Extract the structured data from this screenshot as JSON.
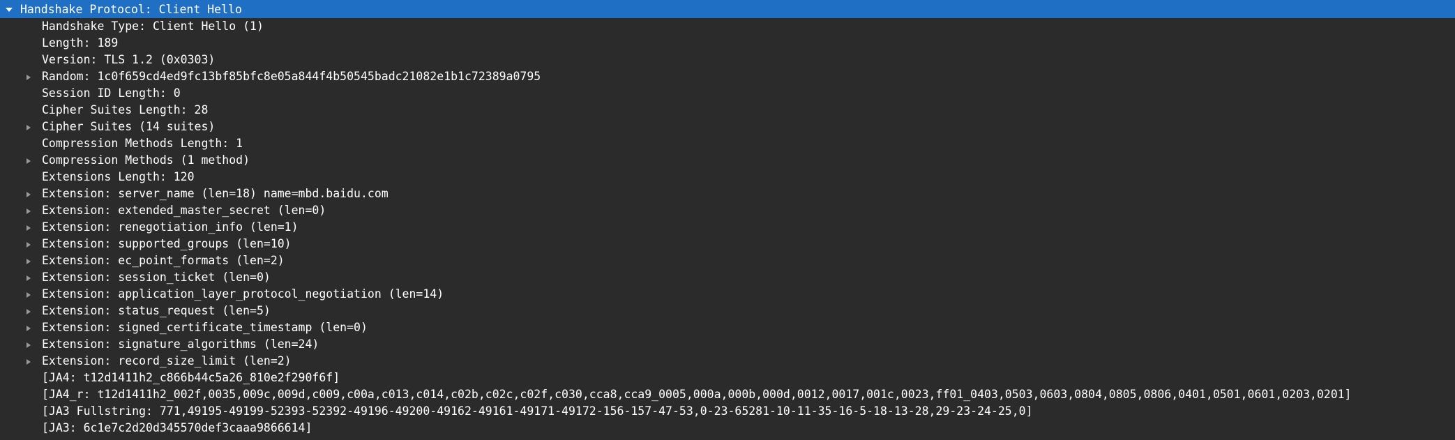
{
  "header": {
    "label": "Handshake Protocol: Client Hello",
    "toggle_icon": "expanded-triangle-icon"
  },
  "rows": [
    {
      "label": "Handshake Type: Client Hello (1)",
      "expandable": false
    },
    {
      "label": "Length: 189",
      "expandable": false
    },
    {
      "label": "Version: TLS 1.2 (0x0303)",
      "expandable": false
    },
    {
      "label": "Random: 1c0f659cd4ed9fc13bf85bfc8e05a844f4b50545badc21082e1b1c72389a0795",
      "expandable": true
    },
    {
      "label": "Session ID Length: 0",
      "expandable": false
    },
    {
      "label": "Cipher Suites Length: 28",
      "expandable": false
    },
    {
      "label": "Cipher Suites (14 suites)",
      "expandable": true
    },
    {
      "label": "Compression Methods Length: 1",
      "expandable": false
    },
    {
      "label": "Compression Methods (1 method)",
      "expandable": true
    },
    {
      "label": "Extensions Length: 120",
      "expandable": false
    },
    {
      "label": "Extension: server_name (len=18) name=mbd.baidu.com",
      "expandable": true
    },
    {
      "label": "Extension: extended_master_secret (len=0)",
      "expandable": true
    },
    {
      "label": "Extension: renegotiation_info (len=1)",
      "expandable": true
    },
    {
      "label": "Extension: supported_groups (len=10)",
      "expandable": true
    },
    {
      "label": "Extension: ec_point_formats (len=2)",
      "expandable": true
    },
    {
      "label": "Extension: session_ticket (len=0)",
      "expandable": true
    },
    {
      "label": "Extension: application_layer_protocol_negotiation (len=14)",
      "expandable": true
    },
    {
      "label": "Extension: status_request (len=5)",
      "expandable": true
    },
    {
      "label": "Extension: signed_certificate_timestamp (len=0)",
      "expandable": true
    },
    {
      "label": "Extension: signature_algorithms (len=24)",
      "expandable": true
    },
    {
      "label": "Extension: record_size_limit (len=2)",
      "expandable": true
    },
    {
      "label": "[JA4: t12d1411h2_c866b44c5a26_810e2f290f6f]",
      "expandable": false
    },
    {
      "label": "[JA4_r: t12d1411h2_002f,0035,009c,009d,c009,c00a,c013,c014,c02b,c02c,c02f,c030,cca8,cca9_0005,000a,000b,000d,0012,0017,001c,0023,ff01_0403,0503,0603,0804,0805,0806,0401,0501,0601,0203,0201]",
      "expandable": false
    },
    {
      "label": "[JA3 Fullstring: 771,49195-49199-52393-52392-49196-49200-49162-49161-49171-49172-156-157-47-53,0-23-65281-10-11-35-16-5-18-13-28,29-23-24-25,0]",
      "expandable": false
    },
    {
      "label": "[JA3: 6c1e7c2d20d345570def3caaa9866614]",
      "expandable": false
    }
  ],
  "colors": {
    "background": "#2b2b2b",
    "selection": "#1f6fc5",
    "text": "#ffffff",
    "toggle": "#c8c8c8"
  }
}
